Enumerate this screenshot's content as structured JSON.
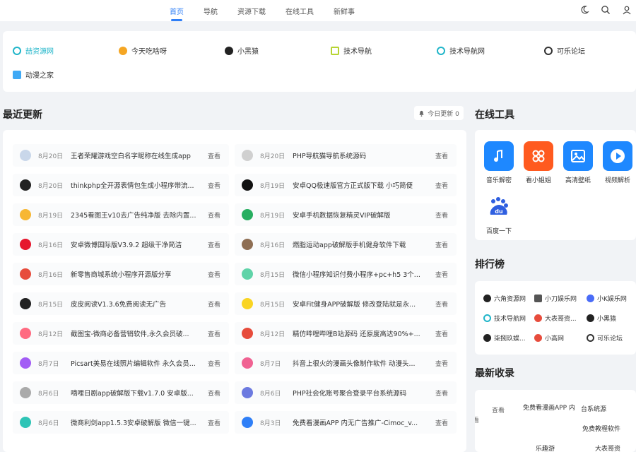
{
  "nav": {
    "links": [
      "首页",
      "导航",
      "资源下载",
      "在线工具",
      "新鲜事"
    ],
    "active": "首页",
    "icons": [
      "moon-icon",
      "search-icon",
      "user-icon"
    ]
  },
  "links": {
    "row1": [
      {
        "label": "喆资源网",
        "icon": "search-icon",
        "color": "#20b5c9"
      },
      {
        "label": "今天吃啥呀",
        "icon": "food-icon",
        "color": "#f5a623"
      },
      {
        "label": "小黑猿",
        "icon": "monkey-icon",
        "color": "#222222"
      },
      {
        "label": "技术导航",
        "icon": "heart-icon",
        "color": "#b7d432"
      },
      {
        "label": "技术导航网",
        "icon": "search-icon",
        "color": "#20b5c9"
      },
      {
        "label": "可乐论坛",
        "icon": "gear-icon",
        "color": "#333333"
      }
    ],
    "row2": [
      {
        "label": "动漫之家",
        "icon": "anime-icon",
        "color": "#3fa9f5"
      }
    ]
  },
  "recent": {
    "title": "最近更新",
    "today_badge": "今日更新 0",
    "view_label": "查看",
    "left": [
      {
        "date": "8月20日",
        "title": "王者荣耀游戏空白名字昵称在线生成app",
        "color": "#c9d7ea"
      },
      {
        "date": "8月20日",
        "title": "thinkphp全开源表情包生成小程序带流...",
        "color": "#222222"
      },
      {
        "date": "8月19日",
        "title": "2345看图王v10去广告纯净版 去除内置...",
        "color": "#f7b733"
      },
      {
        "date": "8月16日",
        "title": "安卓微博国际版V3.9.2 超级干净简洁",
        "color": "#e6162d"
      },
      {
        "date": "8月16日",
        "title": "新零售商城系统小程序开源版分享",
        "color": "#e74c3c"
      },
      {
        "date": "8月15日",
        "title": "皮皮阅读V1.3.6免费阅读无广告",
        "color": "#222222"
      },
      {
        "date": "8月12日",
        "title": "截图宝-微商必备营销软件,永久会员破...",
        "color": "#ff6b81"
      },
      {
        "date": "8月7日",
        "title": "Picsart美易在线照片编辑软件 永久会员...",
        "color": "#a25cf5"
      },
      {
        "date": "8月6日",
        "title": "嘀哩日剧app破解版下载v1.7.0 安卓版...",
        "color": "#aaaaaa"
      },
      {
        "date": "8月6日",
        "title": "微商利剑app1.5.3安卓破解版 微信一键...",
        "color": "#2ec4b6"
      }
    ],
    "right": [
      {
        "date": "8月20日",
        "title": "PHP导航猫导航系统源码",
        "color": "#d0d0d0"
      },
      {
        "date": "8月19日",
        "title": "安卓QQ极速版官方正式版下载 小巧简便",
        "color": "#111111"
      },
      {
        "date": "8月19日",
        "title": "安卓手机数据恢复精灵VIP破解版",
        "color": "#27ae60"
      },
      {
        "date": "8月16日",
        "title": "燃脂运动app破解版手机健身软件下载",
        "color": "#8e6e53"
      },
      {
        "date": "8月15日",
        "title": "微信小程序知识付费小程序+pc+h5 3个...",
        "color": "#5fd3a8"
      },
      {
        "date": "8月15日",
        "title": "安卓Fit健身APP破解版 修改登陆就是永...",
        "color": "#f9d423"
      },
      {
        "date": "8月12日",
        "title": "精仿哔哩哔哩B站源码 还原度高达90%+...",
        "color": "#e74c3c"
      },
      {
        "date": "8月7日",
        "title": "抖音上很火的漫画头像制作软件 动漫头...",
        "color": "#f06292"
      },
      {
        "date": "8月6日",
        "title": "PHP社会化账号聚合登录平台系统源码",
        "color": "#6c7ae0"
      },
      {
        "date": "8月3日",
        "title": "免费看漫画APP 内无广告推广-Cimoc_v...",
        "color": "#2f7ff7"
      }
    ]
  },
  "tools": {
    "title": "在线工具",
    "items": [
      {
        "label": "音乐解密",
        "color": "#1e88ff",
        "glyph": "♪",
        "icon": "music-icon"
      },
      {
        "label": "看小姐姐",
        "color": "#ff5a1f",
        "glyph": "✿",
        "icon": "flower-icon"
      },
      {
        "label": "高清壁纸",
        "color": "#1e88ff",
        "glyph": "▣",
        "icon": "image-icon"
      },
      {
        "label": "视频解析",
        "color": "#1e88ff",
        "glyph": "▶",
        "icon": "play-icon"
      },
      {
        "label": "百度一下",
        "color": "#2f5fe0",
        "glyph": "du",
        "icon": "baidu-icon"
      }
    ]
  },
  "rank": {
    "title": "排行榜",
    "items": [
      {
        "label": "六角资源网",
        "color": "#222222"
      },
      {
        "label": "小刀娱乐网",
        "color": "#555555"
      },
      {
        "label": "小K娱乐网",
        "color": "#4a6cf7"
      },
      {
        "label": "技术导航网",
        "color": "#20b5c9"
      },
      {
        "label": "大表哥资...",
        "color": "#e74c3c"
      },
      {
        "label": "小黑猿",
        "color": "#222222"
      },
      {
        "label": "柒捌玖娱...",
        "color": "#222222"
      },
      {
        "label": "小高网",
        "color": "#e74c3c"
      },
      {
        "label": "可乐论坛",
        "color": "#333333"
      }
    ]
  },
  "latest": {
    "title": "最新收录",
    "lines": [
      "查看",
      "免费看漫画APP 内",
      "台系统源",
      "免费教程软件",
      "查看",
      "乐趣游",
      "大表哥资"
    ]
  }
}
